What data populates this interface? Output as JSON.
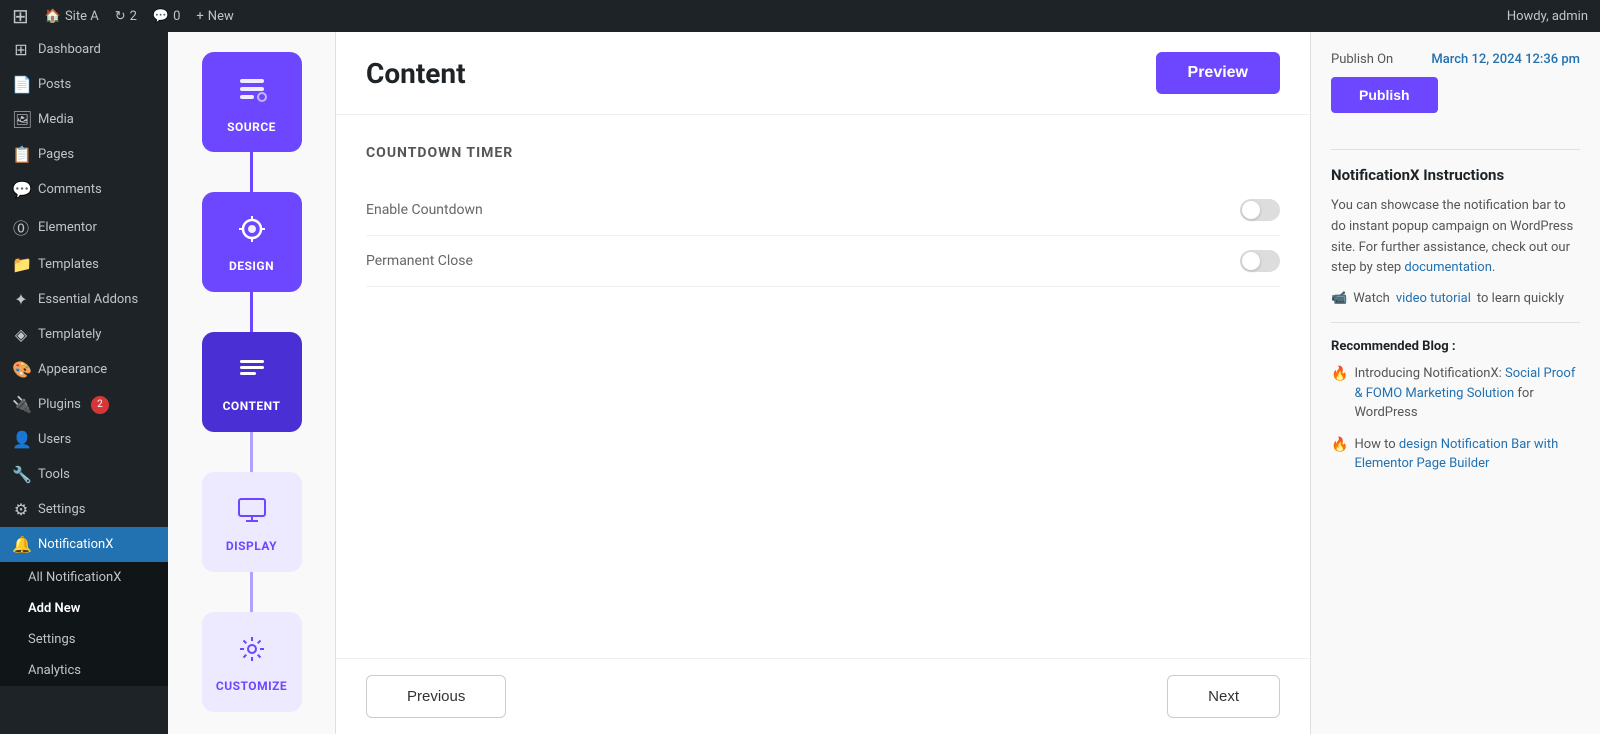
{
  "adminBar": {
    "logoIcon": "⊞",
    "siteLabel": "Site A",
    "updatesCount": "2",
    "commentsCount": "0",
    "newLabel": "New",
    "howdy": "Howdy, admin"
  },
  "sidebar": {
    "items": [
      {
        "id": "dashboard",
        "label": "Dashboard",
        "icon": "⊞"
      },
      {
        "id": "posts",
        "label": "Posts",
        "icon": "📄"
      },
      {
        "id": "media",
        "label": "Media",
        "icon": "🖼"
      },
      {
        "id": "pages",
        "label": "Pages",
        "icon": "📋"
      },
      {
        "id": "comments",
        "label": "Comments",
        "icon": "💬"
      },
      {
        "id": "elementor",
        "label": "Elementor",
        "icon": "⓪"
      },
      {
        "id": "templates",
        "label": "Templates",
        "icon": "📁"
      },
      {
        "id": "essential-addons",
        "label": "Essential Addons",
        "icon": "⊛"
      },
      {
        "id": "templately",
        "label": "Templately",
        "icon": "◈"
      },
      {
        "id": "appearance",
        "label": "Appearance",
        "icon": "🎨"
      },
      {
        "id": "plugins",
        "label": "Plugins",
        "icon": "🔌",
        "badge": "2"
      },
      {
        "id": "users",
        "label": "Users",
        "icon": "👤"
      },
      {
        "id": "tools",
        "label": "Tools",
        "icon": "🔧"
      },
      {
        "id": "settings",
        "label": "Settings",
        "icon": "⚙"
      },
      {
        "id": "notificationx",
        "label": "NotificationX",
        "icon": "🔔"
      }
    ],
    "submenu": {
      "parentId": "notificationx",
      "items": [
        {
          "id": "all-notificationx",
          "label": "All NotificationX"
        },
        {
          "id": "add-new",
          "label": "Add New",
          "active": true
        },
        {
          "id": "settings",
          "label": "Settings"
        },
        {
          "id": "analytics",
          "label": "Analytics"
        }
      ]
    }
  },
  "wizard": {
    "steps": [
      {
        "id": "source",
        "label": "SOURCE",
        "icon": "⊞",
        "state": "active"
      },
      {
        "id": "design",
        "label": "DESIGN",
        "icon": "🎨",
        "state": "active"
      },
      {
        "id": "content",
        "label": "CONTENT",
        "icon": "☰",
        "state": "active"
      },
      {
        "id": "display",
        "label": "DISPLAY",
        "icon": "🖥",
        "state": "inactive"
      },
      {
        "id": "customize",
        "label": "CUSTOMIZE",
        "icon": "⚙",
        "state": "inactive"
      }
    ]
  },
  "editor": {
    "title": "Content",
    "previewLabel": "Preview",
    "sectionHeading": "COUNTDOWN TIMER",
    "fields": [
      {
        "id": "enable-countdown",
        "label": "Enable Countdown"
      },
      {
        "id": "permanent-close",
        "label": "Permanent Close"
      }
    ],
    "previousLabel": "Previous",
    "nextLabel": "Next"
  },
  "rightPanel": {
    "publishLabel": "Publish On",
    "publishDate": "March 12, 2024 12:36 pm",
    "publishButtonLabel": "Publish",
    "instructionsTitle": "NotificationX Instructions",
    "instructionsText": "You can showcase the notification bar to do instant popup campaign on WordPress site. For further assistance, check out our step by step ",
    "documentationLink": "documentation",
    "documentationUrl": "#",
    "watchText": "Watch ",
    "videoTutorialLink": "video tutorial",
    "videoTutorialUrl": "#",
    "watchSuffix": " to learn quickly",
    "recommendedTitle": "Recommended Blog :",
    "blogItems": [
      {
        "id": "blog-1",
        "prefix": "Introducing NotificationX: ",
        "linkText": "Social Proof & FOMO Marketing Solution",
        "suffix": " for WordPress",
        "url": "#"
      },
      {
        "id": "blog-2",
        "prefix": "How to ",
        "linkText": "design Notification Bar with Elementor Page Builder",
        "suffix": "",
        "url": "#"
      }
    ]
  }
}
